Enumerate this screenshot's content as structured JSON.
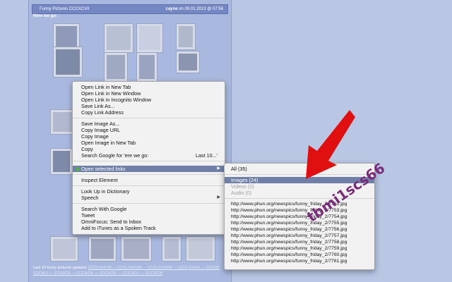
{
  "post": {
    "title": "Funny Pictures CCCXCVII",
    "author": "cayne",
    "date": "on 09.01.2013 @ 07:56",
    "intro": "Here we go:"
  },
  "footer": {
    "prefix": "Last 10 funny pictures updates:",
    "links": "CCCLXXXVII — CCCLXXXVIII — CCCLXXXVIII — CCCLXXXIX — CCCXC",
    "line2": "CCCXCI — CCCXCII — CCCXCIII — CCCXCIV — CCCXCV — CCCXCVI"
  },
  "context_menu": {
    "items": [
      "Open Link in New Tab",
      "Open Link in New Window",
      "Open Link in Incognito Window",
      "Save Link As...",
      "Copy Link Address",
      "Save Image As...",
      "Copy Image URL",
      "Copy Image",
      "Open Image in New Tab",
      "Copy",
      "Search Google for 'ere we go:",
      "Open selected links",
      "Inspect Element",
      "Look Up in Dictionary",
      "Speech",
      "Search With Google",
      "Tweet",
      "OmniFocus: Send to Inbox",
      "Add to iTunes as a Spoken Track"
    ],
    "search_hint": "Last 10...'"
  },
  "submenu": {
    "all": "All (35)",
    "images": "Images (24)",
    "videos": "Videos (0)",
    "audio": "Audio (0)",
    "urls": [
      "http://www.phun.org/newspics/funny_friday_2/7752.jpg",
      "http://www.phun.org/newspics/funny_friday_2/7753.jpg",
      "http://www.phun.org/newspics/funny_friday_2/7754.jpg",
      "http://www.phun.org/newspics/funny_friday_2/7755.jpg",
      "http://www.phun.org/newspics/funny_friday_2/7756.jpg",
      "http://www.phun.org/newspics/funny_friday_2/7757.jpg",
      "http://www.phun.org/newspics/funny_friday_2/7758.jpg",
      "http://www.phun.org/newspics/funny_friday_2/7759.jpg",
      "http://www.phun.org/newspics/funny_friday_2/7760.jpg",
      "http://www.phun.org/newspics/funny_friday_2/7761.jpg"
    ]
  },
  "watermark": "tbmi1scs66",
  "colors": {
    "highlight": "#6f7fa8",
    "arrow": "#e01010",
    "page_bg": "#b9c6e4"
  }
}
